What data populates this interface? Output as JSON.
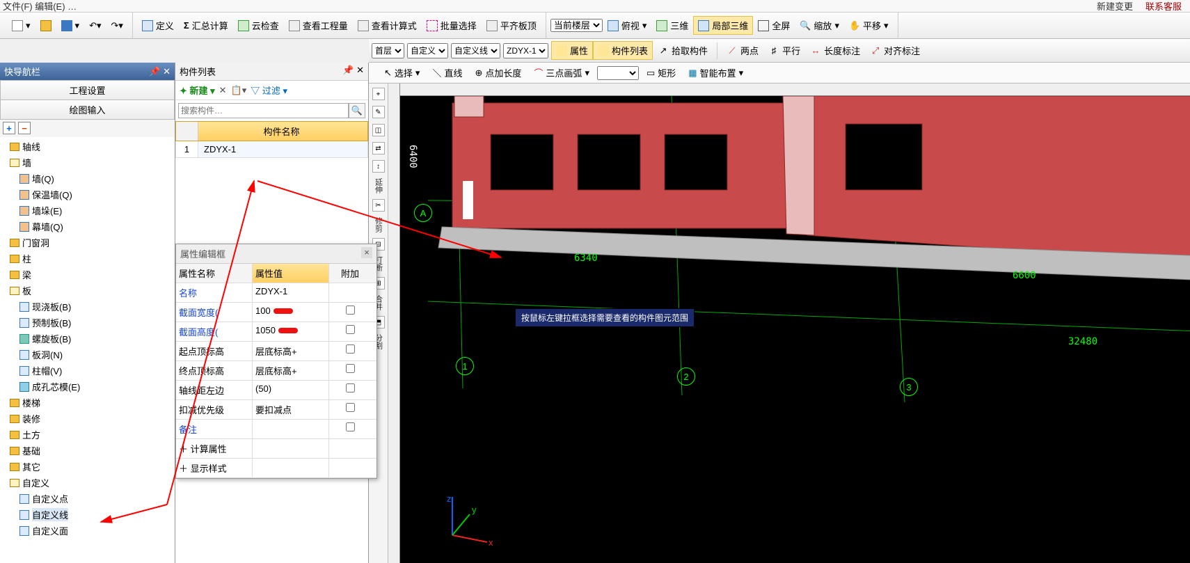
{
  "menu": {
    "right_new": "新建变更",
    "right_contact": "联系客服"
  },
  "toolbar": {
    "define": "定义",
    "sumcalc": "汇总计算",
    "cloudcheck": "云检查",
    "viewqty": "查看工程量",
    "viewexpr": "查看计算式",
    "batchsel": "批量选择",
    "flattop": "平齐板顶",
    "curfloor": "当前楼层",
    "top_view": "俯视",
    "threed": "三维",
    "local3d": "局部三维",
    "fullscreen": "全屏",
    "zoom": "缩放",
    "pan": "平移"
  },
  "toolbar2": {
    "floor": "首层",
    "cat": "自定义",
    "sub": "自定义线",
    "inst": "ZDYX-1",
    "props": "属性",
    "complist": "构件列表",
    "pick": "拾取构件",
    "twopt": "两点",
    "parallel": "平行",
    "lendim": "长度标注",
    "aligndim": "对齐标注"
  },
  "drawbar": {
    "select": "选择",
    "line": "直线",
    "addlen": "点加长度",
    "arc3": "三点画弧",
    "rect": "矩形",
    "smart": "智能布置"
  },
  "nav": {
    "title": "快导航栏",
    "tab_proj": "工程设置",
    "tab_draw": "绘图输入",
    "groups": {
      "axis": "轴线",
      "wall": "墙",
      "wall_q": "墙(Q)",
      "wall_ins": "保温墙(Q)",
      "wall_duo": "墙垛(E)",
      "wall_curtain": "幕墙(Q)",
      "opening": "门窗洞",
      "column": "柱",
      "beam": "梁",
      "slab": "板",
      "slab_cast": "现浇板(B)",
      "slab_pre": "预制板(B)",
      "slab_spiral": "螺旋板(B)",
      "slab_hole": "板洞(N)",
      "slab_cap": "柱帽(V)",
      "slab_core": "成孔芯模(E)",
      "stair": "楼梯",
      "deco": "装修",
      "earth": "土方",
      "found": "基础",
      "other": "其它",
      "custom": "自定义",
      "custom_pt": "自定义点",
      "custom_ln": "自定义线",
      "custom_face": "自定义面"
    }
  },
  "complist": {
    "title": "构件列表",
    "new": "新建",
    "filter": "过滤",
    "search_ph": "搜索构件…",
    "hdr": "构件名称",
    "row1": "ZDYX-1"
  },
  "props": {
    "title": "属性编辑框",
    "h_name": "属性名称",
    "h_val": "属性值",
    "h_add": "附加",
    "r1n": "名称",
    "r1v": "ZDYX-1",
    "r2n": "截面宽度(",
    "r2v": "100",
    "r3n": "截面高度(",
    "r3v": "1050",
    "r4n": "起点顶标高",
    "r4v": "层底标高+",
    "r5n": "终点顶标高",
    "r5v": "层底标高+",
    "r6n": "轴线距左边",
    "r6v": "(50)",
    "r7n": "扣减优先级",
    "r7v": "要扣减点",
    "r8n": "备注",
    "r8v": "",
    "r9n": "计算属性",
    "r10n": "显示样式"
  },
  "canvas": {
    "tooltip": "按鼠标左键拉框选择需要查看的构件图元范围",
    "dim_6400": "6400",
    "dim_6340": "6340",
    "dim_6600": "6600",
    "dim_32480": "32480",
    "axis_A": "A",
    "axis_1": "1",
    "axis_2": "2",
    "axis_3": "3",
    "gizmo_x": "x",
    "gizmo_y": "y",
    "gizmo_z": "z"
  },
  "side": {
    "extend": "延伸",
    "trim": "修剪",
    "break": "打断",
    "merge": "合并",
    "split": "分割"
  }
}
